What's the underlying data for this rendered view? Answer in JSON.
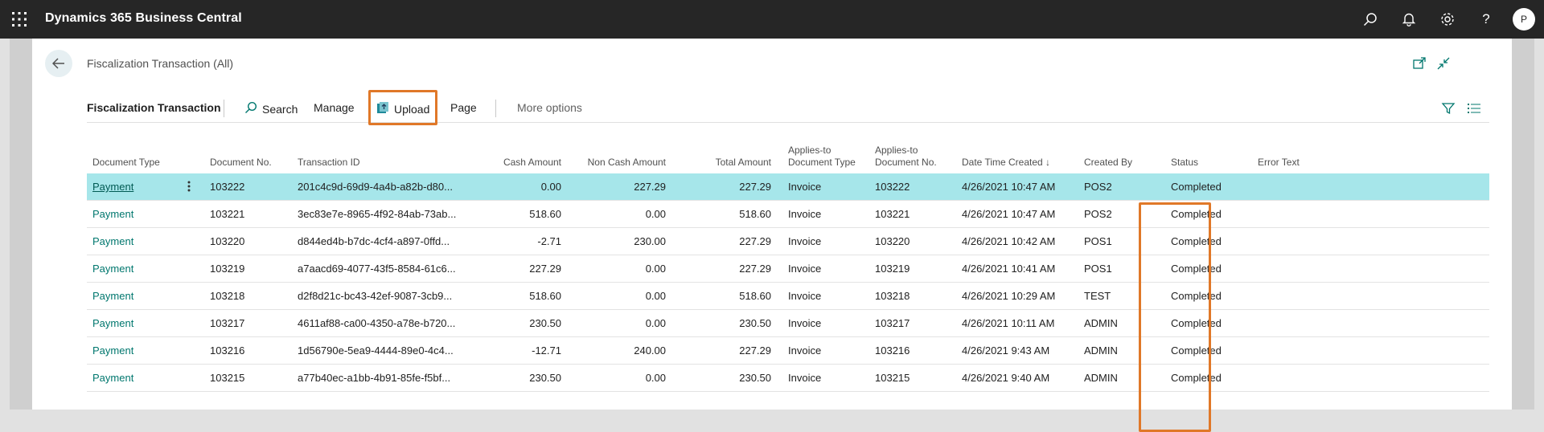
{
  "app": {
    "title": "Dynamics 365 Business Central",
    "avatar_initial": "P"
  },
  "page": {
    "title": "Fiscalization Transaction (All)"
  },
  "actionbar": {
    "title": "Fiscalization Transaction",
    "search": "Search",
    "manage": "Manage",
    "upload": "Upload",
    "page": "Page",
    "more": "More options"
  },
  "columns": {
    "doc_type": "Document Type",
    "doc_no": "Document No.",
    "trans_id": "Transaction ID",
    "cash": "Cash Amount",
    "noncash": "Non Cash Amount",
    "total": "Total Amount",
    "applies_type_1": "Applies-to",
    "applies_type_2": "Document Type",
    "applies_no_1": "Applies-to",
    "applies_no_2": "Document No.",
    "datetime": "Date Time Created ↓",
    "created_by": "Created By",
    "status": "Status",
    "error": "Error Text"
  },
  "rows": [
    {
      "doc_type": "Payment",
      "doc_no": "103222",
      "trans_id": "201c4c9d-69d9-4a4b-a82b-d80...",
      "cash": "0.00",
      "noncash": "227.29",
      "total": "227.29",
      "applies_type": "Invoice",
      "applies_no": "103222",
      "datetime": "4/26/2021 10:47 AM",
      "created_by": "POS2",
      "status": "Completed",
      "error": ""
    },
    {
      "doc_type": "Payment",
      "doc_no": "103221",
      "trans_id": "3ec83e7e-8965-4f92-84ab-73ab...",
      "cash": "518.60",
      "noncash": "0.00",
      "total": "518.60",
      "applies_type": "Invoice",
      "applies_no": "103221",
      "datetime": "4/26/2021 10:47 AM",
      "created_by": "POS2",
      "status": "Completed",
      "error": ""
    },
    {
      "doc_type": "Payment",
      "doc_no": "103220",
      "trans_id": "d844ed4b-b7dc-4cf4-a897-0ffd...",
      "cash": "-2.71",
      "noncash": "230.00",
      "total": "227.29",
      "applies_type": "Invoice",
      "applies_no": "103220",
      "datetime": "4/26/2021 10:42 AM",
      "created_by": "POS1",
      "status": "Completed",
      "error": ""
    },
    {
      "doc_type": "Payment",
      "doc_no": "103219",
      "trans_id": "a7aacd69-4077-43f5-8584-61c6...",
      "cash": "227.29",
      "noncash": "0.00",
      "total": "227.29",
      "applies_type": "Invoice",
      "applies_no": "103219",
      "datetime": "4/26/2021 10:41 AM",
      "created_by": "POS1",
      "status": "Completed",
      "error": ""
    },
    {
      "doc_type": "Payment",
      "doc_no": "103218",
      "trans_id": "d2f8d21c-bc43-42ef-9087-3cb9...",
      "cash": "518.60",
      "noncash": "0.00",
      "total": "518.60",
      "applies_type": "Invoice",
      "applies_no": "103218",
      "datetime": "4/26/2021 10:29 AM",
      "created_by": "TEST",
      "status": "Completed",
      "error": ""
    },
    {
      "doc_type": "Payment",
      "doc_no": "103217",
      "trans_id": "4611af88-ca00-4350-a78e-b720...",
      "cash": "230.50",
      "noncash": "0.00",
      "total": "230.50",
      "applies_type": "Invoice",
      "applies_no": "103217",
      "datetime": "4/26/2021 10:11 AM",
      "created_by": "ADMIN",
      "status": "Completed",
      "error": ""
    },
    {
      "doc_type": "Payment",
      "doc_no": "103216",
      "trans_id": "1d56790e-5ea9-4444-89e0-4c4...",
      "cash": "-12.71",
      "noncash": "240.00",
      "total": "227.29",
      "applies_type": "Invoice",
      "applies_no": "103216",
      "datetime": "4/26/2021 9:43 AM",
      "created_by": "ADMIN",
      "status": "Completed",
      "error": ""
    },
    {
      "doc_type": "Payment",
      "doc_no": "103215",
      "trans_id": "a77b40ec-a1bb-4b91-85fe-f5bf...",
      "cash": "230.50",
      "noncash": "0.00",
      "total": "230.50",
      "applies_type": "Invoice",
      "applies_no": "103215",
      "datetime": "4/26/2021 9:40 AM",
      "created_by": "ADMIN",
      "status": "Completed",
      "error": ""
    }
  ],
  "colors": {
    "accent": "#00776e",
    "highlight_border": "#e07828",
    "selected_row": "#a6e6ea",
    "topbar": "#262626"
  }
}
